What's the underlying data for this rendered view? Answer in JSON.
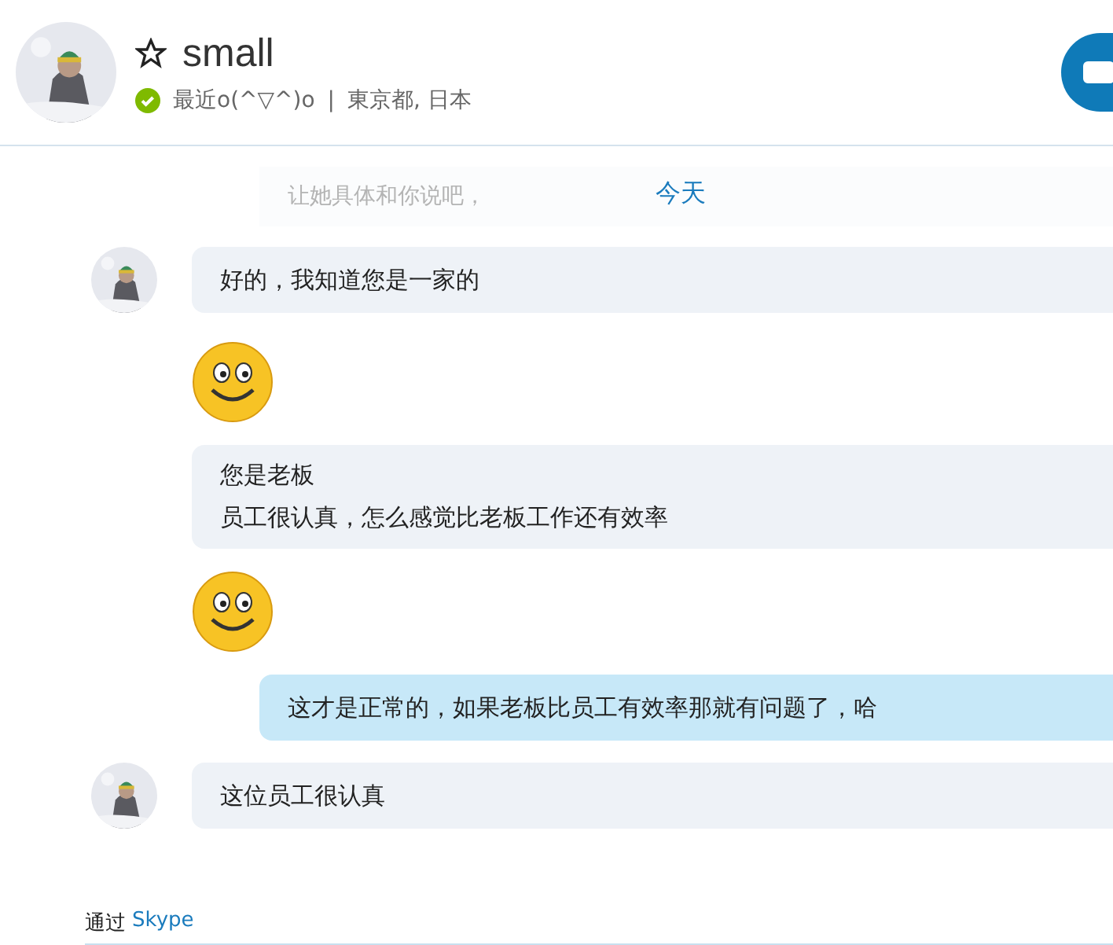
{
  "contact": {
    "name": "small",
    "favorite": false,
    "online": true,
    "mood": "最近o(^▽^)o",
    "separator": "|",
    "location": "東京都, 日本"
  },
  "faded_message": "让她具体和你说吧，",
  "date_label": "今天",
  "messages": [
    {
      "kind": "text",
      "outgoing": false,
      "avatar": true,
      "lines": [
        "好的，我知道您是一家的"
      ]
    },
    {
      "kind": "emoticon",
      "outgoing": false,
      "avatar": false
    },
    {
      "kind": "text",
      "outgoing": false,
      "avatar": false,
      "lines": [
        "您是老板",
        "员工很认真，怎么感觉比老板工作还有效率"
      ]
    },
    {
      "kind": "emoticon",
      "outgoing": false,
      "avatar": false
    },
    {
      "kind": "text",
      "outgoing": true,
      "lines": [
        "这才是正常的，如果老板比员工有效率那就有问题了，哈"
      ]
    },
    {
      "kind": "text",
      "outgoing": false,
      "avatar": true,
      "lines": [
        "这位员工很认真"
      ]
    }
  ],
  "footer": {
    "via": "通过",
    "service": "Skype"
  }
}
